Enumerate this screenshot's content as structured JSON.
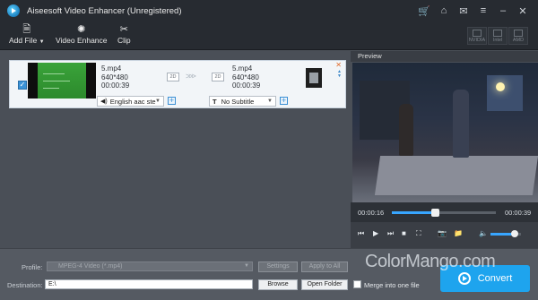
{
  "app": {
    "title": "Aiseesoft Video Enhancer (Unregistered)"
  },
  "window_controls": [
    "🛒",
    "⌂",
    "✉",
    "≡",
    "–",
    "✕"
  ],
  "toolbar": {
    "add_file": "Add File",
    "video_enhance": "Video Enhance",
    "clip": "Clip",
    "accelerators": [
      "NVIDIA",
      "Intel",
      "AMD"
    ]
  },
  "file_item": {
    "source": {
      "name": "5.mp4",
      "resolution": "640*480",
      "duration": "00:00:39",
      "mode": "2D"
    },
    "output": {
      "name": "5.mp4",
      "resolution": "640*480",
      "duration": "00:00:39",
      "mode": "2D"
    },
    "audio_track": "English aac ste",
    "subtitle": "No Subtitle",
    "subtitle_prefix": "T",
    "arrows": ">>>",
    "remove": "✕"
  },
  "preview": {
    "header": "Preview",
    "current_time": "00:00:16",
    "total_time": "00:00:39",
    "progress_fraction": 0.41,
    "volume_fraction": 0.8
  },
  "bottom": {
    "profile_label": "Profile:",
    "profile_value": "MPEG-4 Video (*.mp4)",
    "settings": "Settings",
    "apply_to_all": "Apply to All",
    "destination_label": "Destination:",
    "destination_value": "E:\\",
    "browse": "Browse",
    "open_folder": "Open Folder",
    "merge_label": "Merge into one file",
    "convert": "Convert"
  },
  "watermark": "ColorMango.com",
  "colors": {
    "accent": "#1ea4ee",
    "titlebar": "#272b31",
    "panel": "#4a4f57"
  }
}
